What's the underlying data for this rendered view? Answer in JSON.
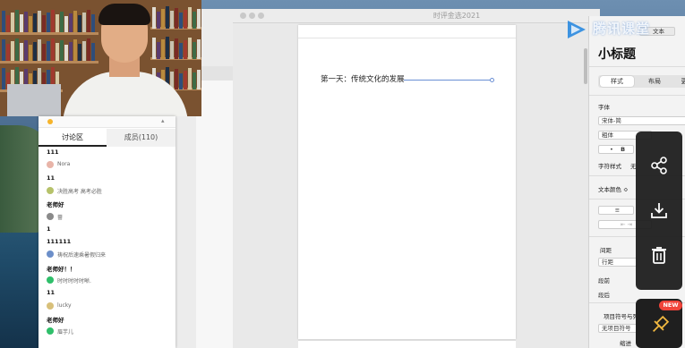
{
  "document_window": {
    "title": "时评金选2021",
    "heading": "第一天：传统文化的发展"
  },
  "inspector": {
    "header_button": "文本",
    "style_name": "小标题",
    "tabs": [
      "样式",
      "布局",
      "更"
    ],
    "font_label": "字体",
    "font_family": "宋体-简",
    "font_weight": "粗体",
    "bold_button": "B",
    "char_style_label": "字符样式",
    "char_style_value": "无",
    "text_color_label": "文本颜色 ≎",
    "spacing_label": "间距",
    "line_spacing": "行距",
    "before_label": "段前",
    "after_label": "段后",
    "bullets_label": "项目符号与列表",
    "bullets_value": "无项目符号",
    "indent_label": "缩进"
  },
  "chat": {
    "tabs": [
      "讨论区",
      "成员(110)"
    ],
    "messages": [
      {
        "type": "text",
        "text": "111"
      },
      {
        "type": "name",
        "name": "Nora",
        "color": "#e8b4a8"
      },
      {
        "type": "text",
        "text": "11"
      },
      {
        "type": "name",
        "name": "决胜高考 高考必胜",
        "color": "#b6c26a"
      },
      {
        "type": "text",
        "text": "老师好"
      },
      {
        "type": "name",
        "name": "蔷",
        "color": "#8a8a8a"
      },
      {
        "type": "text",
        "text": "1"
      },
      {
        "type": "text",
        "text": "111111"
      },
      {
        "type": "name",
        "name": "祷祝后速乘暑假归来",
        "color": "#6c8fc9"
      },
      {
        "type": "text",
        "text": "老师好！！"
      },
      {
        "type": "name",
        "name": "时时时时时晰.",
        "color": "#2fbf6a"
      },
      {
        "type": "text",
        "text": "11"
      },
      {
        "type": "name",
        "name": "lucky",
        "color": "#d8c07a"
      },
      {
        "type": "text",
        "text": "老师好"
      },
      {
        "type": "name",
        "name": "眉芋儿",
        "color": "#2fbf6a"
      }
    ]
  },
  "actions": {
    "share_icon": "share-icon",
    "download_icon": "download-icon",
    "delete_icon": "trash-icon",
    "pin_icon": "pin-icon",
    "new_badge": "NEW"
  },
  "logo": {
    "text": "腾讯课堂",
    "color": "#2a8ae0"
  }
}
